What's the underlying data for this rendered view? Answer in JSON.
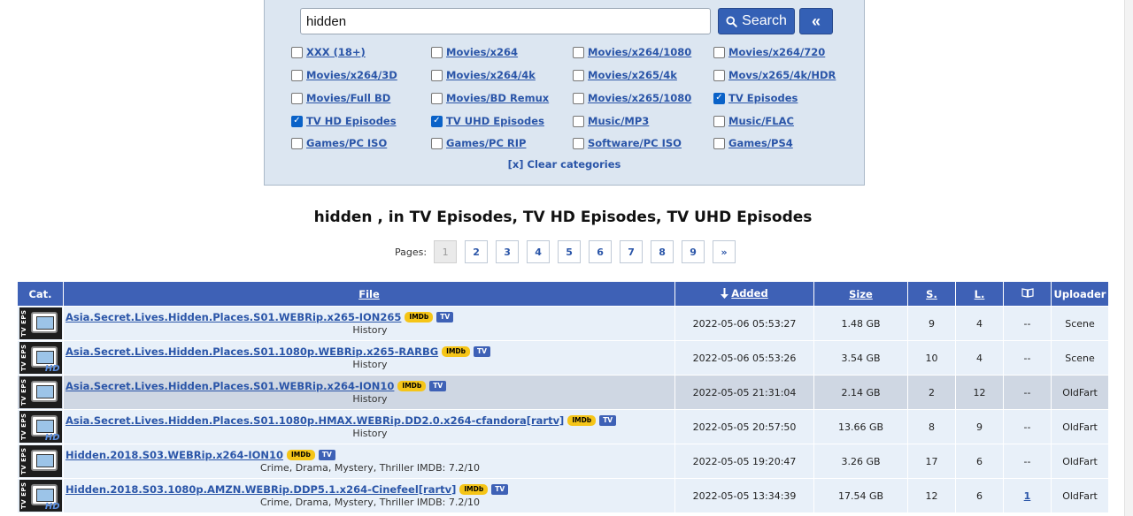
{
  "search": {
    "query": "hidden",
    "button_label": "Search",
    "collapse_label": "«"
  },
  "categories": [
    {
      "label": "XXX (18+)",
      "checked": false
    },
    {
      "label": "Movies/x264",
      "checked": false
    },
    {
      "label": "Movies/x264/1080",
      "checked": false
    },
    {
      "label": "Movies/x264/720",
      "checked": false
    },
    {
      "label": "Movies/x264/3D",
      "checked": false
    },
    {
      "label": "Movies/x264/4k",
      "checked": false
    },
    {
      "label": "Movies/x265/4k",
      "checked": false
    },
    {
      "label": "Movs/x265/4k/HDR",
      "checked": false
    },
    {
      "label": "Movies/Full BD",
      "checked": false
    },
    {
      "label": "Movies/BD Remux",
      "checked": false
    },
    {
      "label": "Movies/x265/1080",
      "checked": false
    },
    {
      "label": "TV Episodes",
      "checked": true
    },
    {
      "label": "TV HD Episodes",
      "checked": true
    },
    {
      "label": "TV UHD Episodes",
      "checked": true
    },
    {
      "label": "Music/MP3",
      "checked": false
    },
    {
      "label": "Music/FLAC",
      "checked": false
    },
    {
      "label": "Games/PC ISO",
      "checked": false
    },
    {
      "label": "Games/PC RIP",
      "checked": false
    },
    {
      "label": "Software/PC ISO",
      "checked": false
    },
    {
      "label": "Games/PS4",
      "checked": false
    }
  ],
  "clear_categories": "[x] Clear categories",
  "result_title": "hidden , in TV Episodes, TV HD Episodes, TV UHD Episodes",
  "pager": {
    "label": "Pages:",
    "pages": [
      "1",
      "2",
      "3",
      "4",
      "5",
      "6",
      "7",
      "8",
      "9",
      "»"
    ],
    "current": "1"
  },
  "table": {
    "headers": {
      "cat": "Cat.",
      "file": "File",
      "added": "Added",
      "size": "Size",
      "seeders": "S.",
      "leechers": "L.",
      "uploader": "Uploader"
    },
    "icon_text": {
      "tv_eps": "TV EPS",
      "hd": "HD"
    },
    "badges": {
      "imdb": "IMDb",
      "tv": "TV"
    },
    "rows": [
      {
        "category": "tv-eps",
        "hd": false,
        "file": "Asia.Secret.Lives.Hidden.Places.S01.WEBRip.x265-ION265",
        "genre": "History",
        "added": "2022-05-06 05:53:27",
        "size": "1.48 GB",
        "seeders": "9",
        "leechers": "4",
        "link": "--",
        "uploader": "Scene",
        "style": "odd"
      },
      {
        "category": "tv-eps",
        "hd": true,
        "file": "Asia.Secret.Lives.Hidden.Places.S01.1080p.WEBRip.x265-RARBG",
        "genre": "History",
        "added": "2022-05-06 05:53:26",
        "size": "3.54 GB",
        "seeders": "10",
        "leechers": "4",
        "link": "--",
        "uploader": "Scene",
        "style": "odd"
      },
      {
        "category": "tv-eps",
        "hd": false,
        "file": "Asia.Secret.Lives.Hidden.Places.S01.WEBRip.x264-ION10",
        "genre": "History",
        "added": "2022-05-05 21:31:04",
        "size": "2.14 GB",
        "seeders": "2",
        "leechers": "12",
        "link": "--",
        "uploader": "OldFart",
        "style": "hl"
      },
      {
        "category": "tv-eps",
        "hd": true,
        "file": "Asia.Secret.Lives.Hidden.Places.S01.1080p.HMAX.WEBRip.DD2.0.x264-cfandora[rartv]",
        "genre": "History",
        "added": "2022-05-05 20:57:50",
        "size": "13.66 GB",
        "seeders": "8",
        "leechers": "9",
        "link": "--",
        "uploader": "OldFart",
        "style": "odd"
      },
      {
        "category": "tv-eps",
        "hd": false,
        "file": "Hidden.2018.S03.WEBRip.x264-ION10",
        "genre": "Crime, Drama, Mystery, Thriller IMDB: 7.2/10",
        "added": "2022-05-05 19:20:47",
        "size": "3.26 GB",
        "seeders": "17",
        "leechers": "6",
        "link": "--",
        "uploader": "OldFart",
        "style": "odd"
      },
      {
        "category": "tv-eps",
        "hd": true,
        "file": "Hidden.2018.S03.1080p.AMZN.WEBRip.DDP5.1.x264-Cinefeel[rartv]",
        "genre": "Crime, Drama, Mystery, Thriller IMDB: 7.2/10",
        "added": "2022-05-05 13:34:39",
        "size": "17.54 GB",
        "seeders": "12",
        "leechers": "6",
        "link": "1",
        "uploader": "OldFart",
        "style": "odd"
      }
    ]
  },
  "colors": {
    "header_bg": "#3e61b6",
    "link": "#2a55a8",
    "seeders": "#c0272d",
    "panel_bg": "#dce6f1"
  }
}
